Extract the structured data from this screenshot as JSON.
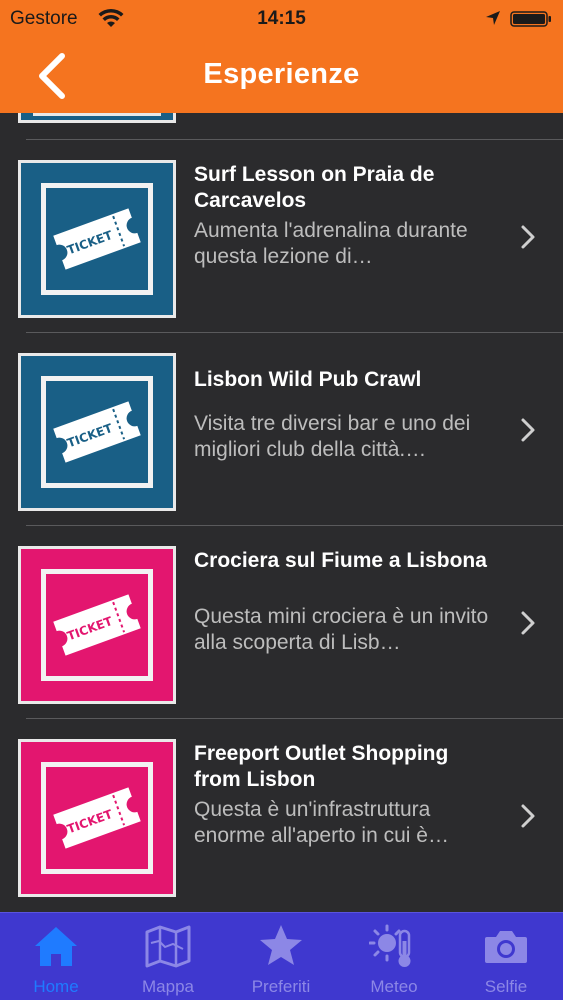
{
  "status_bar": {
    "carrier": "Gestore",
    "time": "14:15"
  },
  "nav": {
    "title": "Esperienze",
    "back_icon": "chevron-left-icon"
  },
  "list": {
    "items": [
      {
        "title": "Surf Lesson on Praia de Carcavelos",
        "description": "Aumenta l'adrenalina durante questa lezione di…",
        "thumb_color": "#195f86",
        "ticket_text": "TICKET"
      },
      {
        "title": "Lisbon Wild Pub Crawl",
        "description": "Visita tre diversi bar e uno dei migliori club della città.…",
        "thumb_color": "#195f86",
        "ticket_text": "TICKET"
      },
      {
        "title": "Crociera sul Fiume a Lisbona",
        "description": "Questa mini crociera è un invito alla scoperta di Lisb…",
        "thumb_color": "#e3166f",
        "ticket_text": "TICKET"
      },
      {
        "title": "Freeport Outlet Shopping from Lisbon",
        "description": "Questa è un'infrastruttura enorme all'aperto in cui è…",
        "thumb_color": "#e3166f",
        "ticket_text": "TICKET"
      }
    ]
  },
  "tabbar": {
    "tabs": [
      {
        "label": "Home",
        "icon": "home-icon",
        "active": true
      },
      {
        "label": "Mappa",
        "icon": "map-icon",
        "active": false
      },
      {
        "label": "Preferiti",
        "icon": "star-icon",
        "active": false
      },
      {
        "label": "Meteo",
        "icon": "weather-icon",
        "active": false
      },
      {
        "label": "Selfie",
        "icon": "camera-icon",
        "active": false
      }
    ]
  },
  "colors": {
    "header": "#f5741f",
    "background": "#2b2b2d",
    "tabbar": "#3f38cf",
    "tab_active": "#1f7bff",
    "tab_inactive": "#8c87e6",
    "blue_thumb": "#195f86",
    "pink_thumb": "#e3166f"
  }
}
